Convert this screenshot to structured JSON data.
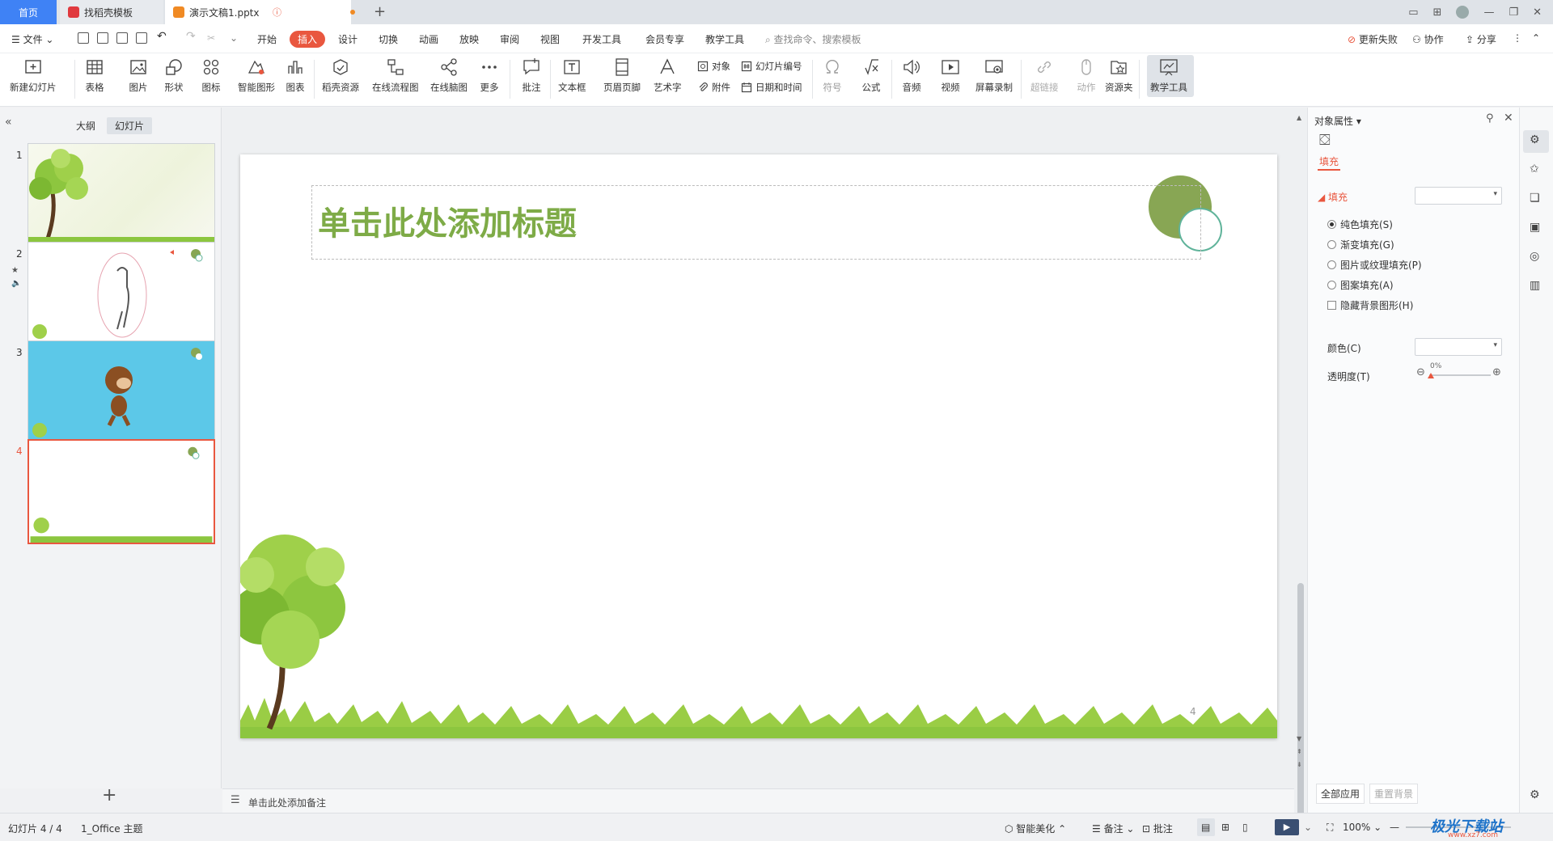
{
  "tabs": {
    "home": "首页",
    "template": "找稻壳模板",
    "document": "演示文稿1.pptx"
  },
  "menu": {
    "file": "文件",
    "items": [
      "开始",
      "插入",
      "设计",
      "切换",
      "动画",
      "放映",
      "审阅",
      "视图",
      "开发工具",
      "会员专享",
      "教学工具"
    ],
    "active": "插入",
    "search_placeholder": "查找命令、搜索模板",
    "update_failed": "更新失败",
    "collaborate": "协作",
    "share": "分享"
  },
  "ribbon": {
    "new_slide": "新建幻灯片",
    "table": "表格",
    "picture": "图片",
    "shape": "形状",
    "icon": "图标",
    "smart_graphic": "智能图形",
    "chart": "图表",
    "docer_resource": "稻壳资源",
    "online_flowchart": "在线流程图",
    "online_mindmap": "在线脑图",
    "more": "更多",
    "comment": "批注",
    "textbox": "文本框",
    "header_footer": "页眉页脚",
    "wordart": "艺术字",
    "object": "对象",
    "slide_number": "幻灯片编号",
    "attachment": "附件",
    "datetime": "日期和时间",
    "symbol": "符号",
    "formula": "公式",
    "audio": "音频",
    "video": "视频",
    "screen_record": "屏幕录制",
    "hyperlink": "超链接",
    "action": "动作",
    "resource_folder": "资源夹",
    "teaching_tools": "教学工具"
  },
  "left_panel": {
    "outline_tab": "大纲",
    "slides_tab": "幻灯片",
    "slide_numbers": [
      "1",
      "2",
      "3",
      "4"
    ],
    "selected": "4",
    "add": "+"
  },
  "slide": {
    "title_placeholder": "单击此处添加标题",
    "page_number": "4",
    "notes_placeholder": "单击此处添加备注"
  },
  "right_panel": {
    "header": "对象属性",
    "fill_tab": "填充",
    "fill_section": "填充",
    "options": [
      "纯色填充(S)",
      "渐变填充(G)",
      "图片或纹理填充(P)",
      "图案填充(A)"
    ],
    "selected_option": "纯色填充(S)",
    "hide_bg": "隐藏背景图形(H)",
    "color_label": "颜色(C)",
    "transparency_label": "透明度(T)",
    "transparency_value": "0%",
    "apply_all": "全部应用",
    "reset_bg": "重置背景"
  },
  "status": {
    "slide_info": "幻灯片 4 / 4",
    "theme": "1_Office 主题",
    "smart_beautify": "智能美化",
    "notes": "备注",
    "comments": "批注",
    "zoom": "100%"
  },
  "watermark": {
    "text": "极光下载站",
    "url": "www.xz7.com"
  },
  "colors": {
    "accent": "#e9573f",
    "home_tab": "#3f82f5",
    "title_green": "#7eab47",
    "circle_green": "#88a654"
  }
}
